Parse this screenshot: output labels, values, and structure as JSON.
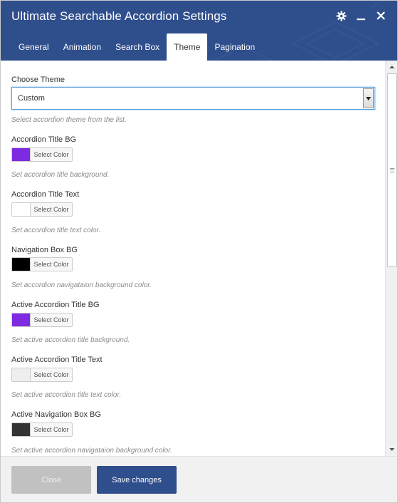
{
  "dialog": {
    "title": "Ultimate Searchable Accordion Settings"
  },
  "header_icons": [
    "gear-icon",
    "minimize-icon",
    "close-icon"
  ],
  "tabs": [
    {
      "label": "General",
      "active": false
    },
    {
      "label": "Animation",
      "active": false
    },
    {
      "label": "Search Box",
      "active": false
    },
    {
      "label": "Theme",
      "active": true
    },
    {
      "label": "Pagination",
      "active": false
    }
  ],
  "theme": {
    "choose_label": "Choose Theme",
    "selected": "Custom",
    "choose_help": "Select accordion theme from the list."
  },
  "color_button_label": "Select Color",
  "color_fields": [
    {
      "label": "Accordion Title BG",
      "color": "#7e2ae0",
      "help": "Set accordion title background."
    },
    {
      "label": "Accordion Title Text",
      "color": "#ffffff",
      "help": "Set accordion title text color."
    },
    {
      "label": "Navigation Box BG",
      "color": "#000000",
      "help": "Set accordion navigataion background color."
    },
    {
      "label": "Active Accordion Title BG",
      "color": "#7e2ae0",
      "help": "Set active accordion title background."
    },
    {
      "label": "Active Accordion Title Text",
      "color": "#eeeeee",
      "help": "Set active accordion title text color."
    },
    {
      "label": "Active Navigation Box BG",
      "color": "#333333",
      "help": "Set active accordion navigataion background color."
    }
  ],
  "footer": {
    "close_label": "Close",
    "save_label": "Save changes"
  },
  "colors": {
    "header_bg": "#2f4e8c",
    "primary_button": "#2f4e8c",
    "disabled_button": "#c1c1c1",
    "focus_border": "#5b9dd9"
  }
}
